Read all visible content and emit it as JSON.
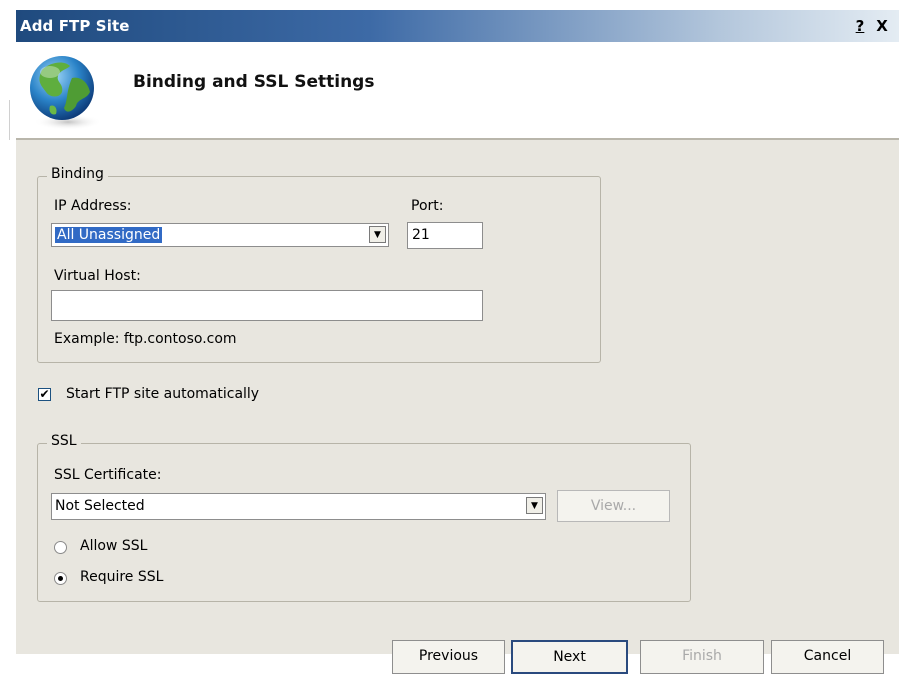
{
  "window": {
    "title": "Add FTP Site",
    "help_label": "?",
    "close_label": "X"
  },
  "header": {
    "title": "Binding and SSL Settings",
    "icon": "globe-icon"
  },
  "binding": {
    "legend": "Binding",
    "ip_label": "IP Address:",
    "ip_value": "All Unassigned",
    "port_label": "Port:",
    "port_value": "21",
    "vhost_label": "Virtual Host:",
    "vhost_value": "",
    "example": "Example: ftp.contoso.com"
  },
  "start_auto": {
    "label": "Start FTP site automatically",
    "checked": true
  },
  "ssl": {
    "legend": "SSL",
    "cert_label": "SSL Certificate:",
    "cert_value": "Not Selected",
    "view_label": "View...",
    "allow_label": "Allow SSL",
    "require_label": "Require SSL",
    "selected": "require"
  },
  "footer": {
    "previous_label": "Previous",
    "next_label": "Next",
    "finish_label": "Finish",
    "cancel_label": "Cancel"
  },
  "colors": {
    "title_bar_start": "#1f4a7e",
    "selection": "#316ac5",
    "dialog_background": "#e8e6df"
  }
}
